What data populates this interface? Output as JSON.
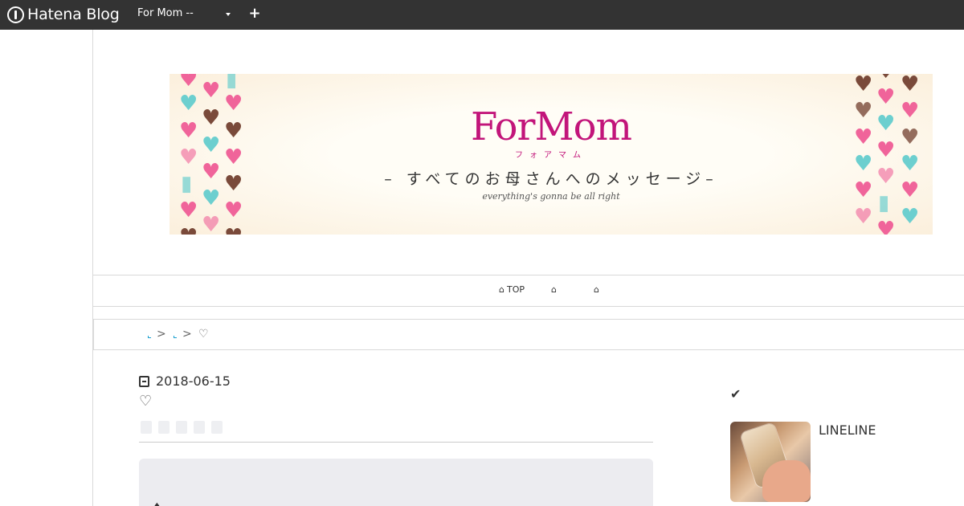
{
  "topbar": {
    "logo_text": "Hatena Blog",
    "blog_select_value": "For Mom --",
    "add_label": "+"
  },
  "banner": {
    "title": "ForMom",
    "kana": "フォアマム",
    "subtitle": "– すべてのお母さんへのメッセージ–",
    "tagline": "everything's gonna be all right",
    "colors": {
      "title": "#c2157a",
      "pink": "#f0649a",
      "teal": "#6ccfcf",
      "brown": "#7a4a3a"
    }
  },
  "nav": {
    "items": [
      {
        "icon": "home-icon",
        "label": "TOP"
      },
      {
        "icon": "home-icon",
        "label": ""
      },
      {
        "icon": "home-icon",
        "label": ""
      }
    ]
  },
  "breadcrumb": {
    "separator": ">",
    "current": "♡"
  },
  "article": {
    "date": "2018-06-15",
    "title": "♡",
    "body_mark": "♠"
  },
  "sidebar": {
    "check_icon": "check-icon",
    "entry_title": "LINELINE"
  }
}
